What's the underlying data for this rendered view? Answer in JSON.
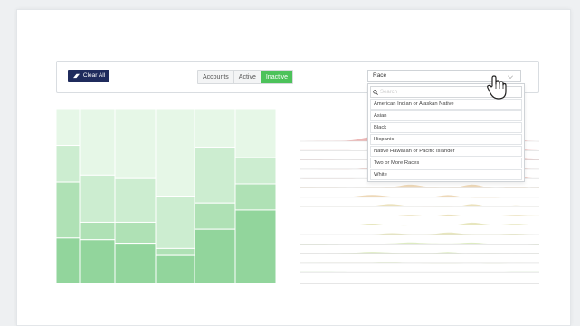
{
  "toolbar": {
    "clear_label": "Clear All",
    "segments": [
      {
        "label": "Accounts",
        "active": false
      },
      {
        "label": "Active",
        "active": false
      },
      {
        "label": "Inactive",
        "active": true
      }
    ],
    "race_select_value": "Race"
  },
  "dropdown": {
    "search_placeholder": "Search",
    "options": [
      "American Indian or Alaskan Native",
      "Asian",
      "Black",
      "Hispanic",
      "Native Hawaiian or Pacific Islander",
      "Two or More Races",
      "White"
    ]
  },
  "colors": {
    "accent_green": "#4cc25a",
    "navy": "#1f2b5c",
    "mosaic_shades": [
      "#e6f7e7",
      "#ccedd0",
      "#afe1b5",
      "#92d59c"
    ],
    "ridge_colors": [
      "#e9aaa9",
      "#ecc4c0",
      "#ead1ab",
      "#e8dcb0",
      "#e3e2b3",
      "#d7e7b6",
      "#c9ebbf"
    ]
  },
  "chart_data": [
    {
      "type": "mosaic",
      "columns": [
        {
          "width": 26,
          "segments": [
            0.21,
            0.21,
            0.32,
            0.26
          ]
        },
        {
          "width": 39,
          "segments": [
            0.38,
            0.27,
            0.1,
            0.25
          ]
        },
        {
          "width": 45,
          "segments": [
            0.4,
            0.25,
            0.12,
            0.23
          ]
        },
        {
          "width": 43,
          "segments": [
            0.5,
            0.3,
            0.04,
            0.16
          ]
        },
        {
          "width": 45,
          "segments": [
            0.22,
            0.32,
            0.15,
            0.31
          ]
        },
        {
          "width": 45,
          "segments": [
            0.28,
            0.15,
            0.15,
            0.42
          ]
        }
      ]
    },
    {
      "type": "area",
      "ridge_peaks": [
        {
          "series": 1,
          "peak": 0.08
        },
        {
          "series": 2,
          "peak": 0.06
        },
        {
          "series": 3,
          "peak": 0.05
        },
        {
          "series": 4,
          "peak": 0.04
        },
        {
          "series": 5,
          "peak": 0.1
        },
        {
          "series": 6,
          "peak": 0.06
        },
        {
          "series": 7,
          "peak": 0.04
        },
        {
          "series": 8,
          "peak": 0.05
        },
        {
          "series": 9,
          "peak": 0.03
        },
        {
          "series": 10,
          "peak": 0.04
        },
        {
          "series": 11,
          "peak": 0.03
        },
        {
          "series": 12,
          "peak": 0.02
        },
        {
          "series": 13,
          "peak": 0.02
        },
        {
          "series": 14,
          "peak": 0.01
        },
        {
          "series": 15,
          "peak": 0.01
        }
      ]
    }
  ]
}
